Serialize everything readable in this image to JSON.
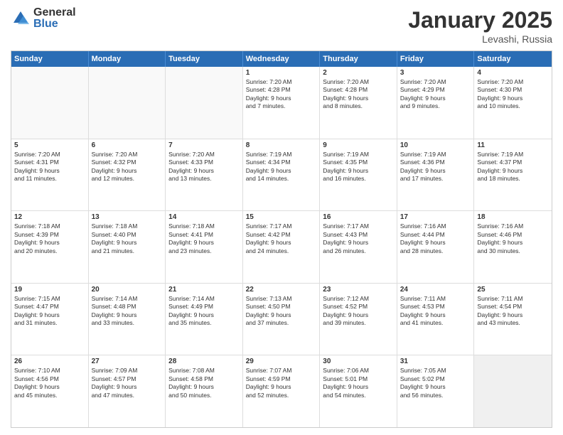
{
  "header": {
    "logo_general": "General",
    "logo_blue": "Blue",
    "month_year": "January 2025",
    "location": "Levashi, Russia"
  },
  "days_of_week": [
    "Sunday",
    "Monday",
    "Tuesday",
    "Wednesday",
    "Thursday",
    "Friday",
    "Saturday"
  ],
  "weeks": [
    [
      {
        "day": "",
        "info": ""
      },
      {
        "day": "",
        "info": ""
      },
      {
        "day": "",
        "info": ""
      },
      {
        "day": "1",
        "info": "Sunrise: 7:20 AM\nSunset: 4:28 PM\nDaylight: 9 hours\nand 7 minutes."
      },
      {
        "day": "2",
        "info": "Sunrise: 7:20 AM\nSunset: 4:28 PM\nDaylight: 9 hours\nand 8 minutes."
      },
      {
        "day": "3",
        "info": "Sunrise: 7:20 AM\nSunset: 4:29 PM\nDaylight: 9 hours\nand 9 minutes."
      },
      {
        "day": "4",
        "info": "Sunrise: 7:20 AM\nSunset: 4:30 PM\nDaylight: 9 hours\nand 10 minutes."
      }
    ],
    [
      {
        "day": "5",
        "info": "Sunrise: 7:20 AM\nSunset: 4:31 PM\nDaylight: 9 hours\nand 11 minutes."
      },
      {
        "day": "6",
        "info": "Sunrise: 7:20 AM\nSunset: 4:32 PM\nDaylight: 9 hours\nand 12 minutes."
      },
      {
        "day": "7",
        "info": "Sunrise: 7:20 AM\nSunset: 4:33 PM\nDaylight: 9 hours\nand 13 minutes."
      },
      {
        "day": "8",
        "info": "Sunrise: 7:19 AM\nSunset: 4:34 PM\nDaylight: 9 hours\nand 14 minutes."
      },
      {
        "day": "9",
        "info": "Sunrise: 7:19 AM\nSunset: 4:35 PM\nDaylight: 9 hours\nand 16 minutes."
      },
      {
        "day": "10",
        "info": "Sunrise: 7:19 AM\nSunset: 4:36 PM\nDaylight: 9 hours\nand 17 minutes."
      },
      {
        "day": "11",
        "info": "Sunrise: 7:19 AM\nSunset: 4:37 PM\nDaylight: 9 hours\nand 18 minutes."
      }
    ],
    [
      {
        "day": "12",
        "info": "Sunrise: 7:18 AM\nSunset: 4:39 PM\nDaylight: 9 hours\nand 20 minutes."
      },
      {
        "day": "13",
        "info": "Sunrise: 7:18 AM\nSunset: 4:40 PM\nDaylight: 9 hours\nand 21 minutes."
      },
      {
        "day": "14",
        "info": "Sunrise: 7:18 AM\nSunset: 4:41 PM\nDaylight: 9 hours\nand 23 minutes."
      },
      {
        "day": "15",
        "info": "Sunrise: 7:17 AM\nSunset: 4:42 PM\nDaylight: 9 hours\nand 24 minutes."
      },
      {
        "day": "16",
        "info": "Sunrise: 7:17 AM\nSunset: 4:43 PM\nDaylight: 9 hours\nand 26 minutes."
      },
      {
        "day": "17",
        "info": "Sunrise: 7:16 AM\nSunset: 4:44 PM\nDaylight: 9 hours\nand 28 minutes."
      },
      {
        "day": "18",
        "info": "Sunrise: 7:16 AM\nSunset: 4:46 PM\nDaylight: 9 hours\nand 30 minutes."
      }
    ],
    [
      {
        "day": "19",
        "info": "Sunrise: 7:15 AM\nSunset: 4:47 PM\nDaylight: 9 hours\nand 31 minutes."
      },
      {
        "day": "20",
        "info": "Sunrise: 7:14 AM\nSunset: 4:48 PM\nDaylight: 9 hours\nand 33 minutes."
      },
      {
        "day": "21",
        "info": "Sunrise: 7:14 AM\nSunset: 4:49 PM\nDaylight: 9 hours\nand 35 minutes."
      },
      {
        "day": "22",
        "info": "Sunrise: 7:13 AM\nSunset: 4:50 PM\nDaylight: 9 hours\nand 37 minutes."
      },
      {
        "day": "23",
        "info": "Sunrise: 7:12 AM\nSunset: 4:52 PM\nDaylight: 9 hours\nand 39 minutes."
      },
      {
        "day": "24",
        "info": "Sunrise: 7:11 AM\nSunset: 4:53 PM\nDaylight: 9 hours\nand 41 minutes."
      },
      {
        "day": "25",
        "info": "Sunrise: 7:11 AM\nSunset: 4:54 PM\nDaylight: 9 hours\nand 43 minutes."
      }
    ],
    [
      {
        "day": "26",
        "info": "Sunrise: 7:10 AM\nSunset: 4:56 PM\nDaylight: 9 hours\nand 45 minutes."
      },
      {
        "day": "27",
        "info": "Sunrise: 7:09 AM\nSunset: 4:57 PM\nDaylight: 9 hours\nand 47 minutes."
      },
      {
        "day": "28",
        "info": "Sunrise: 7:08 AM\nSunset: 4:58 PM\nDaylight: 9 hours\nand 50 minutes."
      },
      {
        "day": "29",
        "info": "Sunrise: 7:07 AM\nSunset: 4:59 PM\nDaylight: 9 hours\nand 52 minutes."
      },
      {
        "day": "30",
        "info": "Sunrise: 7:06 AM\nSunset: 5:01 PM\nDaylight: 9 hours\nand 54 minutes."
      },
      {
        "day": "31",
        "info": "Sunrise: 7:05 AM\nSunset: 5:02 PM\nDaylight: 9 hours\nand 56 minutes."
      },
      {
        "day": "",
        "info": ""
      }
    ]
  ]
}
